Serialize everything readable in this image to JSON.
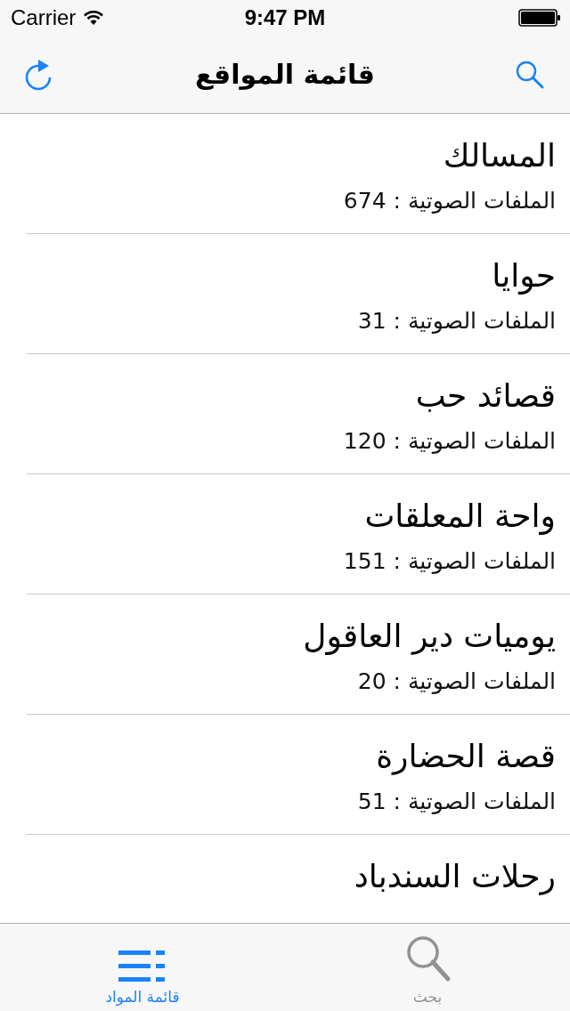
{
  "status_bar": {
    "carrier": "Carrier",
    "time": "9:47 PM"
  },
  "nav_bar": {
    "title": "قائمة المواقع"
  },
  "sites": [
    {
      "title": "المسالك",
      "subtitle": "الملفات الصوتية : 674"
    },
    {
      "title": "حوايا",
      "subtitle": "الملفات الصوتية : 31"
    },
    {
      "title": "قصائد حب",
      "subtitle": "الملفات الصوتية : 120"
    },
    {
      "title": "واحة المعلقات",
      "subtitle": "الملفات الصوتية : 151"
    },
    {
      "title": "يوميات دير العاقول",
      "subtitle": "الملفات الصوتية : 20"
    },
    {
      "title": "قصة الحضارة",
      "subtitle": "الملفات الصوتية : 51"
    },
    {
      "title": "رحلات السندباد"
    }
  ],
  "tab_bar": [
    {
      "label": "بحث",
      "kind": "search",
      "selected": false
    },
    {
      "label": "قائمة المواد",
      "kind": "list",
      "selected": true
    }
  ]
}
